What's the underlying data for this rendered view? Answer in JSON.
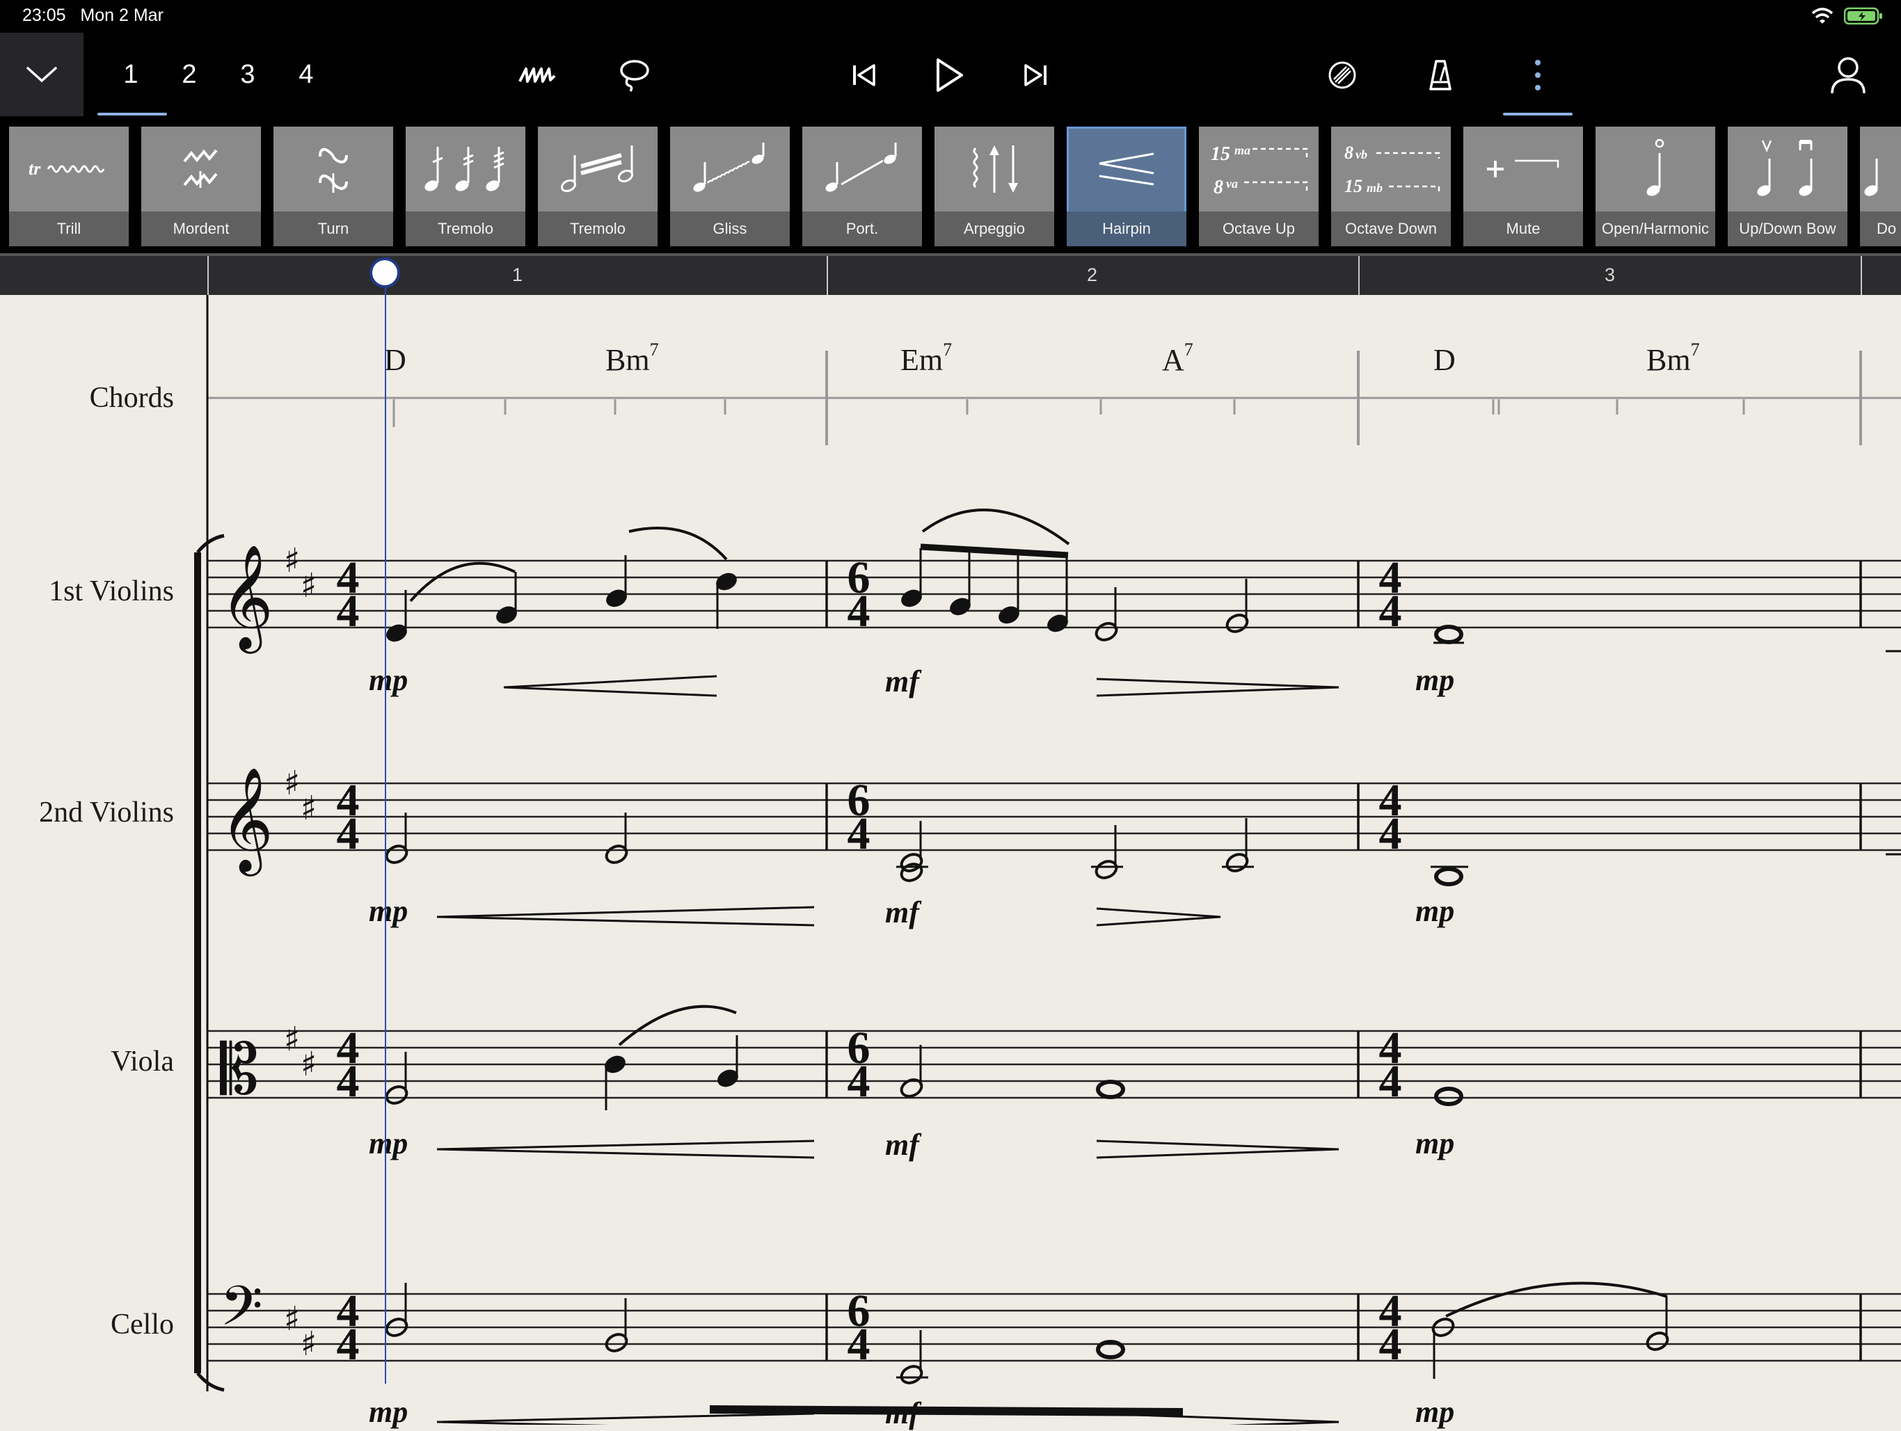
{
  "status": {
    "time": "23:05",
    "date": "Mon 2 Mar"
  },
  "toolbar": {
    "pages": [
      "1",
      "2",
      "3",
      "4"
    ],
    "active_page": "1",
    "icons": [
      "collapse-chevron-icon",
      "handwriting-icon",
      "lasso-icon",
      "skip-back-icon",
      "play-icon",
      "skip-forward-icon",
      "sound-icon",
      "metronome-icon",
      "more-icon",
      "account-icon"
    ]
  },
  "palette": {
    "items": [
      {
        "label": "Trill"
      },
      {
        "label": "Mordent"
      },
      {
        "label": "Turn"
      },
      {
        "label": "Tremolo"
      },
      {
        "label": "Tremolo"
      },
      {
        "label": "Gliss"
      },
      {
        "label": "Port."
      },
      {
        "label": "Arpeggio"
      },
      {
        "label": "Hairpin",
        "selected": true
      },
      {
        "label": "Octave Up"
      },
      {
        "label": "Octave Down"
      },
      {
        "label": "Mute"
      },
      {
        "label": "Open/Harmonic"
      },
      {
        "label": "Up/Down Bow"
      },
      {
        "label": "Do"
      }
    ],
    "selected": "Hairpin"
  },
  "ruler": {
    "bars": [
      "1",
      "2",
      "3"
    ]
  },
  "score": {
    "chords_label": "Chords",
    "chords": [
      {
        "root": "D",
        "ext": ""
      },
      {
        "root": "Bm",
        "ext": "7"
      },
      {
        "root": "Em",
        "ext": "7"
      },
      {
        "root": "A",
        "ext": "7"
      },
      {
        "root": "D",
        "ext": ""
      },
      {
        "root": "Bm",
        "ext": "7"
      }
    ],
    "instruments": [
      "1st Violins",
      "2nd Violins",
      "Viola",
      "Cello"
    ],
    "time_signatures": [
      "4/4",
      "6/4",
      "4/4"
    ],
    "dynamics": {
      "violin1": [
        "mp",
        "mf",
        "mp"
      ],
      "violin2": [
        "mp",
        "mf",
        "mp"
      ],
      "viola": [
        "mp",
        "mf",
        "mp"
      ],
      "cello": [
        "mp",
        "mf",
        "mp"
      ]
    }
  },
  "colors": {
    "background": "#efece6",
    "toolbar": "#000000",
    "accent": "#8fb3e6",
    "playhead": "#2f4aa8",
    "selected_tool": "#5c7596"
  }
}
